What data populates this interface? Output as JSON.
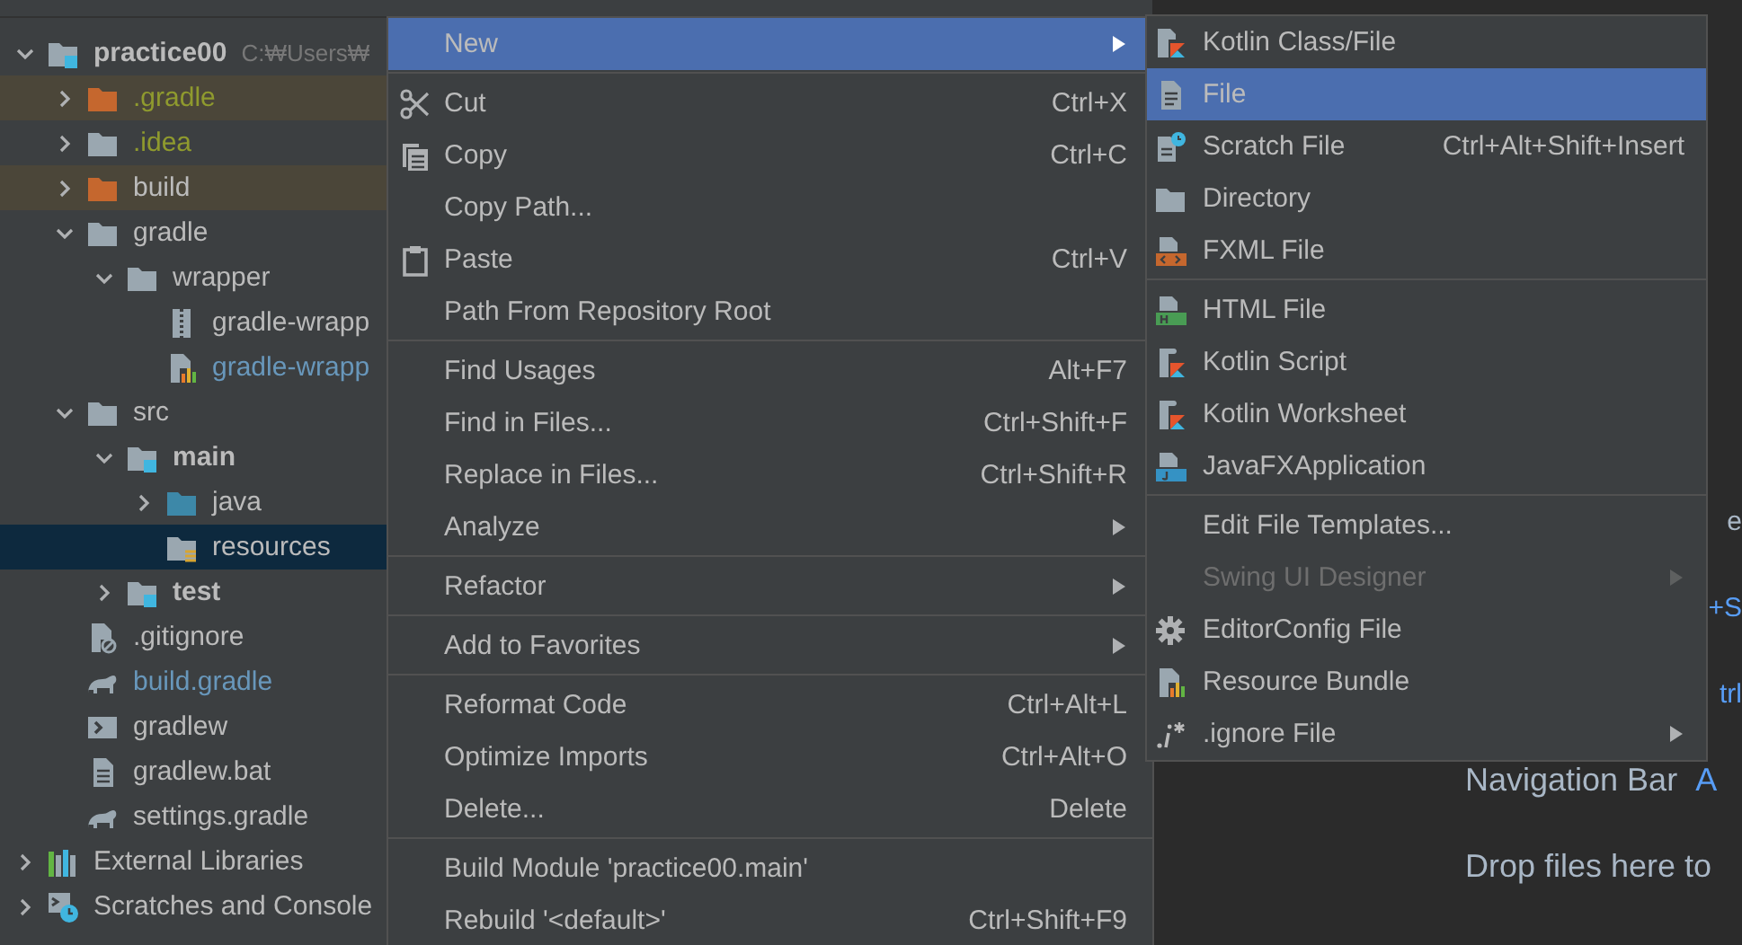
{
  "project_tree": [
    {
      "label": "practice00",
      "path": "C:₩Users₩",
      "kind": "module-folder",
      "expanded": true,
      "bold": true,
      "ignored": false,
      "modified": false,
      "excluded": false,
      "selected": false,
      "children": [
        {
          "label": ".gradle",
          "kind": "excluded-folder",
          "expanded": false,
          "bold": false,
          "ignored": true,
          "modified": false,
          "excluded": true,
          "selected": false
        },
        {
          "label": ".idea",
          "kind": "folder",
          "expanded": false,
          "bold": false,
          "ignored": true,
          "modified": false,
          "excluded": false,
          "selected": false
        },
        {
          "label": "build",
          "kind": "excluded-folder",
          "expanded": false,
          "bold": false,
          "ignored": false,
          "modified": false,
          "excluded": true,
          "selected": false
        },
        {
          "label": "gradle",
          "kind": "folder",
          "expanded": true,
          "bold": false,
          "ignored": false,
          "modified": false,
          "excluded": false,
          "selected": false,
          "children": [
            {
              "label": "wrapper",
              "kind": "folder",
              "expanded": true,
              "bold": false,
              "ignored": false,
              "modified": false,
              "excluded": false,
              "selected": false,
              "children": [
                {
                  "label": "gradle-wrapp",
                  "kind": "archive",
                  "bold": false,
                  "ignored": false,
                  "modified": false,
                  "excluded": false,
                  "selected": false
                },
                {
                  "label": "gradle-wrapp",
                  "kind": "properties",
                  "bold": false,
                  "ignored": false,
                  "modified": true,
                  "excluded": false,
                  "selected": false
                }
              ]
            }
          ]
        },
        {
          "label": "src",
          "kind": "folder",
          "expanded": true,
          "bold": false,
          "ignored": false,
          "modified": false,
          "excluded": false,
          "selected": false,
          "children": [
            {
              "label": "main",
              "kind": "module-folder",
              "expanded": true,
              "bold": true,
              "ignored": false,
              "modified": false,
              "excluded": false,
              "selected": false,
              "children": [
                {
                  "label": "java",
                  "kind": "source-folder",
                  "expanded": false,
                  "bold": false,
                  "ignored": false,
                  "modified": false,
                  "excluded": false,
                  "selected": false
                },
                {
                  "label": "resources",
                  "kind": "resources-folder",
                  "bold": false,
                  "ignored": false,
                  "modified": false,
                  "excluded": false,
                  "selected": true
                }
              ]
            },
            {
              "label": "test",
              "kind": "module-folder",
              "expanded": false,
              "bold": true,
              "ignored": false,
              "modified": false,
              "excluded": false,
              "selected": false
            }
          ]
        },
        {
          "label": ".gitignore",
          "kind": "ignore-file",
          "bold": false,
          "ignored": false,
          "modified": false,
          "excluded": false,
          "selected": false
        },
        {
          "label": "build.gradle",
          "kind": "gradle",
          "bold": false,
          "ignored": false,
          "modified": true,
          "excluded": false,
          "selected": false
        },
        {
          "label": "gradlew",
          "kind": "script",
          "bold": false,
          "ignored": false,
          "modified": false,
          "excluded": false,
          "selected": false
        },
        {
          "label": "gradlew.bat",
          "kind": "text-file",
          "bold": false,
          "ignored": false,
          "modified": false,
          "excluded": false,
          "selected": false
        },
        {
          "label": "settings.gradle",
          "kind": "gradle",
          "bold": false,
          "ignored": false,
          "modified": false,
          "excluded": false,
          "selected": false
        }
      ]
    },
    {
      "label": "External Libraries",
      "kind": "libraries",
      "expanded": false,
      "bold": false,
      "ignored": false,
      "modified": false,
      "excluded": false,
      "selected": false
    },
    {
      "label": "Scratches and Console",
      "kind": "scratches",
      "expanded": false,
      "bold": false,
      "ignored": false,
      "modified": false,
      "excluded": false,
      "selected": false
    }
  ],
  "context_menu": [
    [
      {
        "label": "New",
        "submenu": true,
        "selected": true,
        "disabled": false
      }
    ],
    [
      {
        "label": "Cut",
        "shortcut": "Ctrl+X",
        "kind": "scissors",
        "submenu": false,
        "selected": false,
        "disabled": false
      },
      {
        "label": "Copy",
        "shortcut": "Ctrl+C",
        "kind": "copy",
        "submenu": false,
        "selected": false,
        "disabled": false
      },
      {
        "label": "Copy Path...",
        "submenu": false,
        "selected": false,
        "disabled": false
      },
      {
        "label": "Paste",
        "shortcut": "Ctrl+V",
        "kind": "clipboard",
        "submenu": false,
        "selected": false,
        "disabled": false
      },
      {
        "label": "Path From Repository Root",
        "submenu": false,
        "selected": false,
        "disabled": false
      }
    ],
    [
      {
        "label": "Find Usages",
        "shortcut": "Alt+F7",
        "submenu": false,
        "selected": false,
        "disabled": false
      },
      {
        "label": "Find in Files...",
        "shortcut": "Ctrl+Shift+F",
        "submenu": false,
        "selected": false,
        "disabled": false
      },
      {
        "label": "Replace in Files...",
        "shortcut": "Ctrl+Shift+R",
        "submenu": false,
        "selected": false,
        "disabled": false
      },
      {
        "label": "Analyze",
        "submenu": true,
        "selected": false,
        "disabled": false
      }
    ],
    [
      {
        "label": "Refactor",
        "submenu": true,
        "selected": false,
        "disabled": false
      }
    ],
    [
      {
        "label": "Add to Favorites",
        "submenu": true,
        "selected": false,
        "disabled": false
      }
    ],
    [
      {
        "label": "Reformat Code",
        "shortcut": "Ctrl+Alt+L",
        "submenu": false,
        "selected": false,
        "disabled": false
      },
      {
        "label": "Optimize Imports",
        "shortcut": "Ctrl+Alt+O",
        "submenu": false,
        "selected": false,
        "disabled": false
      },
      {
        "label": "Delete...",
        "shortcut": "Delete",
        "submenu": false,
        "selected": false,
        "disabled": false
      }
    ],
    [
      {
        "label": "Build Module 'practice00.main'",
        "submenu": false,
        "selected": false,
        "disabled": false
      },
      {
        "label": "Rebuild '<default>'",
        "shortcut": "Ctrl+Shift+F9",
        "submenu": false,
        "selected": false,
        "disabled": false
      }
    ]
  ],
  "new_submenu": [
    [
      {
        "label": "Kotlin Class/File",
        "kind": "kotlin-file",
        "submenu": false,
        "selected": false,
        "disabled": false
      },
      {
        "label": "File",
        "kind": "file",
        "submenu": false,
        "selected": true,
        "disabled": false
      },
      {
        "label": "Scratch File",
        "shortcut": "Ctrl+Alt+Shift+Insert",
        "kind": "scratch-file",
        "submenu": false,
        "selected": false,
        "disabled": false
      },
      {
        "label": "Directory",
        "kind": "folder",
        "submenu": false,
        "selected": false,
        "disabled": false
      },
      {
        "label": "FXML File",
        "kind": "fxml-file",
        "submenu": false,
        "selected": false,
        "disabled": false
      }
    ],
    [
      {
        "label": "HTML File",
        "kind": "html-file",
        "submenu": false,
        "selected": false,
        "disabled": false
      },
      {
        "label": "Kotlin Script",
        "kind": "kotlin-script",
        "submenu": false,
        "selected": false,
        "disabled": false
      },
      {
        "label": "Kotlin Worksheet",
        "kind": "kotlin-script",
        "submenu": false,
        "selected": false,
        "disabled": false
      },
      {
        "label": "JavaFXApplication",
        "kind": "javafx-file",
        "submenu": false,
        "selected": false,
        "disabled": false
      }
    ],
    [
      {
        "label": "Edit File Templates...",
        "submenu": false,
        "selected": false,
        "disabled": false
      },
      {
        "label": "Swing UI Designer",
        "submenu": true,
        "selected": false,
        "disabled": true
      },
      {
        "label": "EditorConfig File",
        "kind": "gear",
        "submenu": false,
        "selected": false,
        "disabled": false
      },
      {
        "label": "Resource Bundle",
        "kind": "properties",
        "submenu": false,
        "selected": false,
        "disabled": false
      },
      {
        "label": ".ignore File",
        "kind": "ignore-glyph",
        "submenu": true,
        "selected": false,
        "disabled": false
      }
    ]
  ],
  "editor_hints": [
    {
      "kind": "clipped",
      "label": "e"
    },
    {
      "kind": "clipped",
      "shortcut": "+S"
    },
    {
      "kind": "clipped",
      "shortcut": "trl"
    },
    {
      "kind": "full",
      "label": "Navigation Bar",
      "shortcut": "A"
    },
    {
      "kind": "full",
      "label": "Drop files here to"
    }
  ]
}
